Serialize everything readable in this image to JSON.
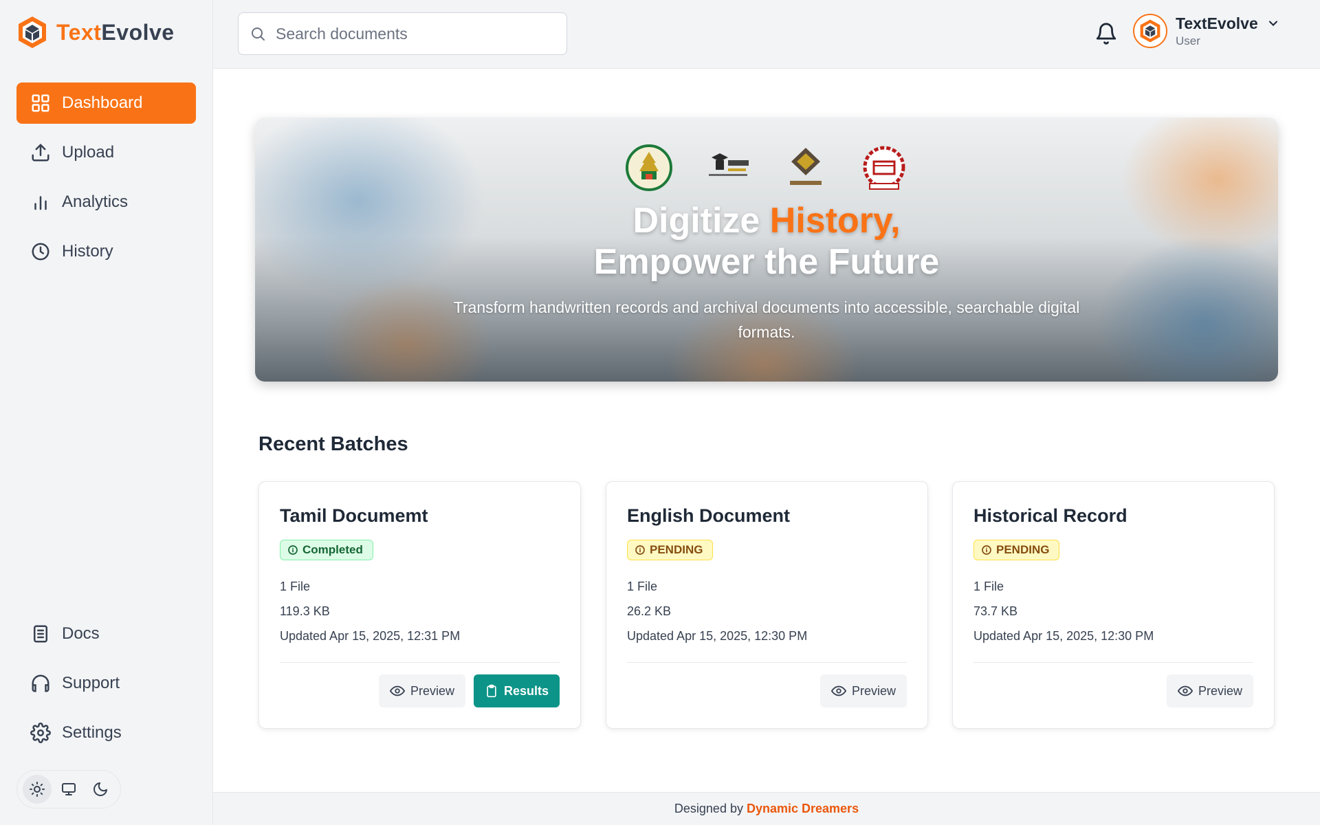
{
  "app": {
    "logo_part1": "Text",
    "logo_part2": "Evolve",
    "accent_color": "#f97316"
  },
  "sidebar": {
    "items": [
      {
        "label": "Dashboard",
        "icon": "grid-icon",
        "active": true
      },
      {
        "label": "Upload",
        "icon": "upload-icon"
      },
      {
        "label": "Analytics",
        "icon": "bar-chart-icon"
      },
      {
        "label": "History",
        "icon": "clock-icon"
      }
    ],
    "bottom_items": [
      {
        "label": "Docs",
        "icon": "document-icon"
      },
      {
        "label": "Support",
        "icon": "headphones-icon"
      },
      {
        "label": "Settings",
        "icon": "gear-icon"
      }
    ],
    "theme_options": [
      "light",
      "system",
      "dark"
    ],
    "theme_selected": "light"
  },
  "header": {
    "search_placeholder": "Search documents",
    "user_name": "TextEvolve",
    "user_role": "User"
  },
  "hero": {
    "title_line1_plain": "Digitize ",
    "title_line1_highlight": "History,",
    "title_line2": "Empower the Future",
    "subtitle": "Transform handwritten records and archival documents into accessible, searchable digital formats."
  },
  "recent": {
    "title": "Recent Batches",
    "batches": [
      {
        "title": "Tamil Documemt",
        "status": "Completed",
        "files": "1 File",
        "size": "119.3 KB",
        "updated": "Updated Apr 15, 2025, 12:31 PM",
        "preview_label": "Preview",
        "results_label": "Results"
      },
      {
        "title": "English Document",
        "status": "PENDING",
        "files": "1 File",
        "size": "26.2 KB",
        "updated": "Updated Apr 15, 2025, 12:30 PM",
        "preview_label": "Preview"
      },
      {
        "title": "Historical Record",
        "status": "PENDING",
        "files": "1 File",
        "size": "73.7 KB",
        "updated": "Updated Apr 15, 2025, 12:30 PM",
        "preview_label": "Preview"
      }
    ]
  },
  "footer": {
    "prefix": "Designed by",
    "brand": "Dynamic Dreamers"
  }
}
